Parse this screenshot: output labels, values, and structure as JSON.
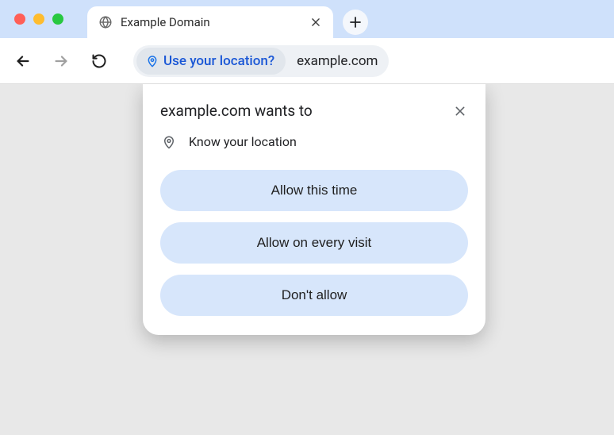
{
  "window": {
    "traffic_lights": {
      "close": "close",
      "minimize": "minimize",
      "maximize": "maximize"
    }
  },
  "tab": {
    "title": "Example Domain",
    "favicon": "globe-icon"
  },
  "toolbar": {
    "back": "Back",
    "forward": "Forward",
    "reload": "Reload",
    "location_chip_text": "Use your location?",
    "url": "example.com"
  },
  "permission_prompt": {
    "title": "example.com wants to",
    "permission_label": "Know your location",
    "buttons": {
      "allow_once": "Allow this time",
      "allow_always": "Allow on every visit",
      "deny": "Don't allow"
    }
  }
}
